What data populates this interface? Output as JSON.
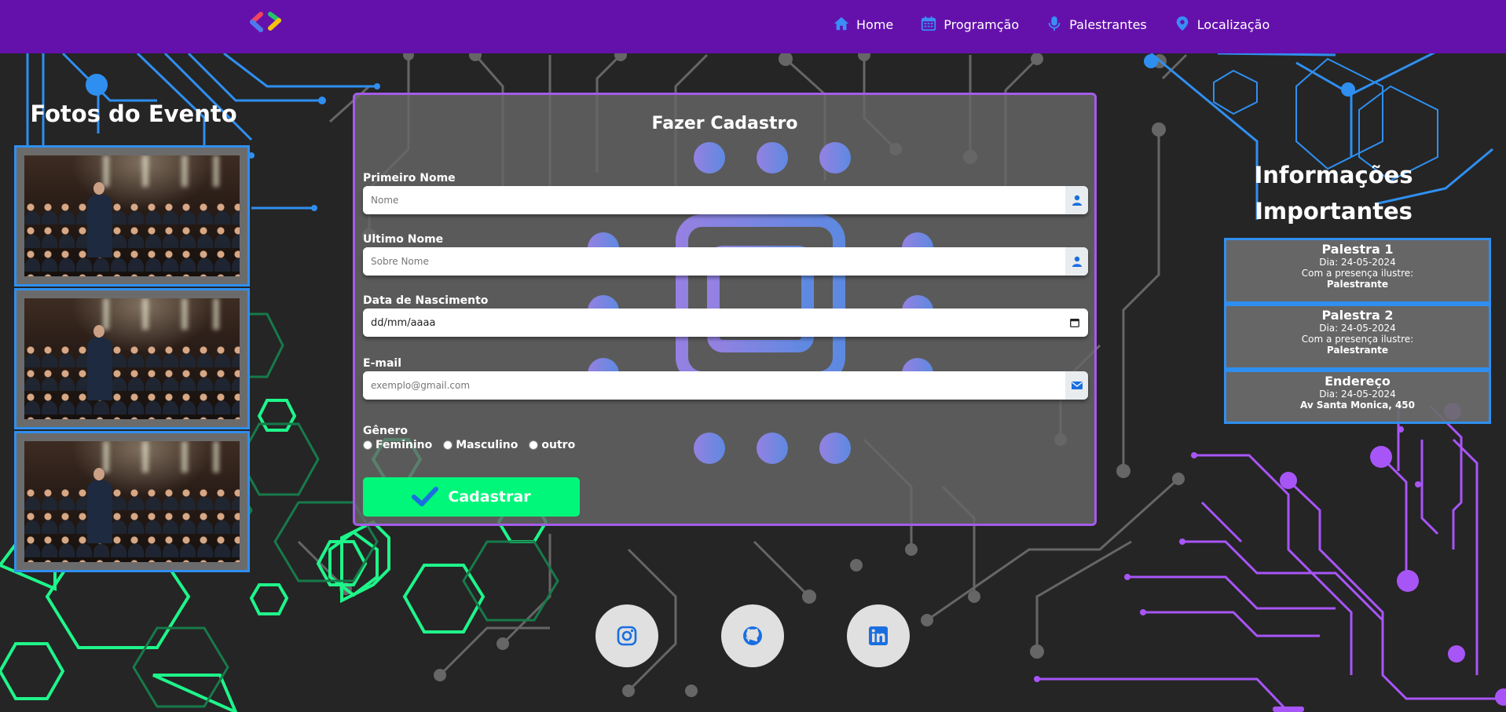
{
  "nav": {
    "items": [
      {
        "label": "Home",
        "icon": "home-icon"
      },
      {
        "label": "Programção",
        "icon": "calendar-icon"
      },
      {
        "label": "Palestrantes",
        "icon": "microphone-icon"
      },
      {
        "label": "Localização",
        "icon": "location-pin-icon"
      }
    ]
  },
  "gallery": {
    "title": "Fotos do Evento",
    "photos": [
      {
        "alt": "speaker-on-stage-photo"
      },
      {
        "alt": "speaker-on-stage-photo"
      },
      {
        "alt": "speaker-on-stage-photo"
      }
    ]
  },
  "form": {
    "title": "Fazer Cadastro",
    "first_name": {
      "label": "Primeiro Nome",
      "placeholder": "Nome"
    },
    "last_name": {
      "label": "Ultimo Nome",
      "placeholder": "Sobre Nome"
    },
    "birthdate": {
      "label": "Data de Nascimento",
      "value": "dd/mm/aaaa"
    },
    "email": {
      "label": "E-mail",
      "placeholder": "exemplo@gmail.com"
    },
    "gender": {
      "label": "Gênero",
      "options": [
        "Feminino",
        "Masculino",
        "outro"
      ]
    },
    "submit_label": "Cadastrar"
  },
  "info": {
    "title_line1": "Informações",
    "title_line2": "Importantes",
    "cards": [
      {
        "title": "Palestra 1",
        "line1": "Dia: 24-05-2024",
        "line2": "Com a presença ilustre:",
        "bold": "Palestrante"
      },
      {
        "title": "Palestra 2",
        "line1": "Dia: 24-05-2024",
        "line2": "Com a presença ilustre:",
        "bold": "Palestrante"
      },
      {
        "title": "Endereço",
        "line1": "Dia: 24-05-2024",
        "bold": "Av Santa Monica, 450"
      }
    ]
  },
  "social": [
    {
      "icon": "instagram-icon"
    },
    {
      "icon": "github-icon"
    },
    {
      "icon": "linkedin-icon"
    }
  ],
  "colors": {
    "header": "#6411ac",
    "background": "#252525",
    "accent_blue": "#2f8ff0",
    "form_border": "#a45ce8",
    "submit": "#00f779",
    "circuit_green": "#1ef58a",
    "circuit_purple": "#a855f7"
  }
}
